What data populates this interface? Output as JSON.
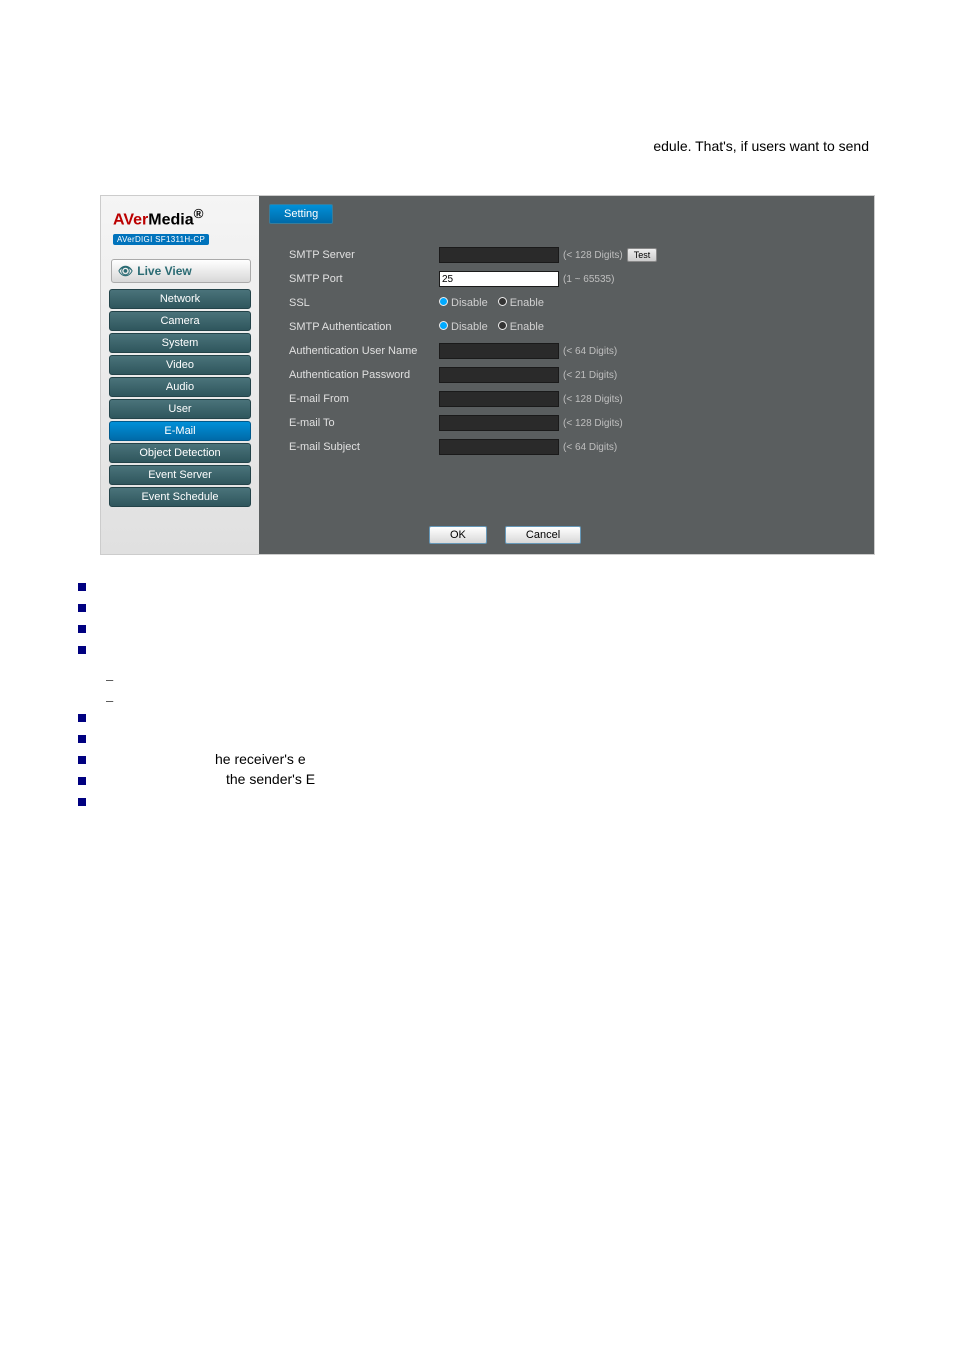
{
  "page": {
    "top_text": "edule. That's, if users want to send"
  },
  "logo": {
    "brand_a": "AVer",
    "brand_b": "Media",
    "subline": "AVerDIGI SF1311H-CP"
  },
  "liveview": {
    "eye": "👁",
    "label": "Live View"
  },
  "nav": {
    "items": [
      {
        "label": "Network"
      },
      {
        "label": "Camera"
      },
      {
        "label": "System"
      },
      {
        "label": "Video"
      },
      {
        "label": "Audio"
      },
      {
        "label": "User"
      },
      {
        "label": "E-Mail"
      },
      {
        "label": "Object Detection"
      },
      {
        "label": "Event Server"
      },
      {
        "label": "Event Schedule"
      }
    ]
  },
  "tab": {
    "label": "Setting"
  },
  "form": {
    "smtp_server": {
      "label": "SMTP Server",
      "value": "",
      "hint": "(< 128 Digits)",
      "test": "Test"
    },
    "smtp_port": {
      "label": "SMTP Port",
      "value": "25",
      "hint": "(1 ~ 65535)"
    },
    "ssl": {
      "label": "SSL",
      "disable": "Disable",
      "enable": "Enable"
    },
    "smtp_auth": {
      "label": "SMTP Authentication",
      "disable": "Disable",
      "enable": "Enable"
    },
    "auth_user": {
      "label": "Authentication User Name",
      "value": "",
      "hint": "(< 64 Digits)"
    },
    "auth_pass": {
      "label": "Authentication Password",
      "value": "",
      "hint": "(< 21 Digits)"
    },
    "email_from": {
      "label": "E-mail From",
      "value": "",
      "hint": "(< 128 Digits)"
    },
    "email_to": {
      "label": "E-mail To",
      "value": "",
      "hint": "(< 128 Digits)"
    },
    "email_subject": {
      "label": "E-mail Subject",
      "value": "",
      "hint": "(< 64 Digits)"
    }
  },
  "buttons": {
    "ok": "OK",
    "cancel": "Cancel"
  },
  "body_text": {
    "receiver": "he receiver's e",
    "sender": "the sender's E"
  },
  "dashes": {
    "d1": "–",
    "d2": "–"
  }
}
